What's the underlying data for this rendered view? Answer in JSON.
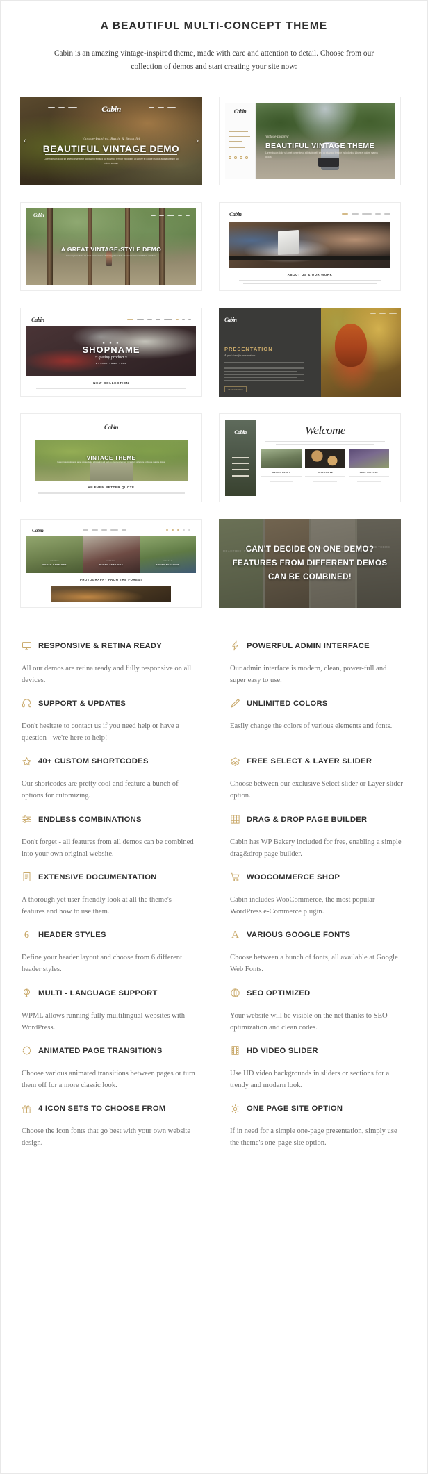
{
  "header": {
    "title": "A BEAUTIFUL MULTI-CONCEPT THEME",
    "subtitle": "Cabin is an amazing vintage-inspired theme, made with care and attention to detail. Choose from our collection of demos and start creating your site now:"
  },
  "brand": {
    "name": "Cabin",
    "accent": "#c9a96a",
    "text_dark": "#2e2e2e",
    "text_muted": "#6e6e6e"
  },
  "demos": [
    {
      "id": "beautiful-vintage-demo",
      "logo": "Cabin",
      "tagline": "Vintage-Inspired, Rustic & Beautiful",
      "headline": "BEAUTIFUL VINTAGE DEMO",
      "blurb": "Lorem ipsum dolor sit amet consectetur adipiscing elit sed do eiusmod tempor incididunt ut labore et dolore magna aliqua ut enim ad minim veniam",
      "prev": "‹",
      "next": "›"
    },
    {
      "id": "beautiful-vintage-theme",
      "logo": "Cabin",
      "eyebrow": "Vintage-Inspired",
      "headline": "BEAUTIFUL VINTAGE THEME",
      "blurb": "Lorem ipsum dolor sit amet consectetur adipiscing elit sed do eiusmod tempor incididunt ut labore et dolore magna aliqua"
    },
    {
      "id": "great-vintage-style-demo",
      "logo": "Cabin",
      "headline": "A GREAT VINTAGE-STYLE DEMO",
      "blurb": "Lorem ipsum dolor sit amet consectetur adipiscing elit sed do eiusmod tempor incididunt ut labore"
    },
    {
      "id": "about-us-our-work",
      "logo": "Cabin",
      "caption": "ABOUT US & OUR WORK"
    },
    {
      "id": "shopname-new-collection",
      "logo": "Cabin",
      "badge_stars": "★ ★ ★",
      "badge_name": "SHOPNAME",
      "badge_quality": "~ quality product ~",
      "badge_est": "ESTABLISHED 1984",
      "caption": "NEW COLLECTION",
      "nav": [
        "HOME",
        "PAGES",
        "BLOG",
        "SHOP",
        "CONTACT"
      ]
    },
    {
      "id": "presentation",
      "logo": "Cabin",
      "title": "PRESENTATION",
      "subtitle": "A great demo for presentations",
      "button": "LEARN MORE"
    },
    {
      "id": "vintage-theme-quote",
      "logo": "Cabin",
      "headline": "VINTAGE THEME",
      "blurb": "Lorem ipsum dolor sit amet consectetur adipiscing elit sed do eiusmod tempor incididunt ut labore et dolore magna aliqua",
      "caption": "AN EVEN BETTER QUOTE",
      "nav": [
        "HOME",
        "PAGES",
        "PORTFOLIO",
        "BLOG",
        "CONTACT"
      ]
    },
    {
      "id": "welcome",
      "logo": "Cabin",
      "welcome": "Welcome",
      "thumb_captions": [
        "RETINA READY",
        "RESPONSIVE",
        "FREE SUPPORT"
      ],
      "nav": [
        "HOME",
        "PAGES",
        "PORTFOLIO",
        "BLOG",
        "CONTACT"
      ]
    },
    {
      "id": "photo-sessions",
      "logo": "Cabin",
      "tiles": [
        {
          "eyebrow": "VINTAGE",
          "label": "PHOTO SESSIONS"
        },
        {
          "eyebrow": "VINTAGE",
          "label": "PHOTO SESSIONS"
        },
        {
          "eyebrow": "VINTAGE",
          "label": "PHOTO SESSIONS"
        }
      ],
      "caption": "PHOTOGRAPHY FROM THE FOREST",
      "nav": [
        "HOME",
        "ABOUT",
        "PAGES",
        "CONTACT",
        "SHOP"
      ]
    },
    {
      "id": "combine-demos-callout",
      "message": "CAN'T DECIDE ON ONE DEMO? FEATURES FROM DIFFERENT DEMOS CAN BE COMBINED!",
      "ghost_labels": [
        "BEAUTIFUL VINTAGE DEMO",
        "BEAUTIFUL VINTAGE DEMO",
        "BEAUTIFUL VINTAGE THEME"
      ]
    }
  ],
  "features": [
    {
      "icon": "monitor-icon",
      "title": "RESPONSIVE & RETINA READY",
      "desc": "All our demos are retina ready and fully responsive on all devices."
    },
    {
      "icon": "lightning-bolt-icon",
      "title": "POWERFUL ADMIN INTERFACE",
      "desc": "Our admin interface is modern, clean, power-full and super easy to use."
    },
    {
      "icon": "headphones-icon",
      "title": "SUPPORT & UPDATES",
      "desc": "Don't hesitate to contact us if you need help or have a question - we're here to help!"
    },
    {
      "icon": "pencil-icon",
      "title": "UNLIMITED COLORS",
      "desc": "Easily change the colors of various elements and fonts."
    },
    {
      "icon": "star-icon",
      "title": "40+ CUSTOM SHORTCODES",
      "desc": "Our shortcodes are pretty cool and feature a bunch of options for cutomizing."
    },
    {
      "icon": "layers-icon",
      "title": "FREE SELECT & LAYER SLIDER",
      "desc": "Choose between our exclusive Select slider or Layer slider option."
    },
    {
      "icon": "sliders-icon",
      "title": "ENDLESS COMBINATIONS",
      "desc": "Don't forget - all features from all demos can be combined into your own original website."
    },
    {
      "icon": "grid-icon",
      "title": "DRAG & DROP PAGE BUILDER",
      "desc": "Cabin has WP Bakery included for free, enabling a simple drag&drop page builder."
    },
    {
      "icon": "document-icon",
      "title": "EXTENSIVE DOCUMENTATION",
      "desc": "A thorough yet user-friendly look at all the theme's features and how to use them."
    },
    {
      "icon": "shopping-cart-icon",
      "title": "WOOCOMMERCE SHOP",
      "desc": "Cabin includes WooCommerce, the most popular WordPress e-Commerce plugin."
    },
    {
      "icon": "number-six-icon",
      "title": "HEADER STYLES",
      "desc": "Define your header layout and choose from 6 different header styles."
    },
    {
      "icon": "letter-a-icon",
      "title": "VARIOUS GOOGLE FONTS",
      "desc": "Choose between a bunch of fonts, all available at Google Web Fonts."
    },
    {
      "icon": "globe-stand-icon",
      "title": "MULTI - LANGUAGE SUPPORT",
      "desc": "WPML allows running fully multilingual websites with WordPress."
    },
    {
      "icon": "globe-icon",
      "title": "SEO OPTIMIZED",
      "desc": "Your website will be visible on the net thanks to SEO optimization and clean codes."
    },
    {
      "icon": "spinner-icon",
      "title": "ANIMATED PAGE TRANSITIONS",
      "desc": "Choose various animated transitions between pages or turn them off for a more classic look."
    },
    {
      "icon": "film-strip-icon",
      "title": "HD VIDEO SLIDER",
      "desc": "Use HD video backgrounds in sliders or sections for a trendy and modern look."
    },
    {
      "icon": "gift-icon",
      "title": "4 ICON SETS TO CHOOSE FROM",
      "desc": "Choose the icon fonts that go best with your own website design."
    },
    {
      "icon": "gear-icon",
      "title": "ONE PAGE SITE OPTION",
      "desc": "If in need for a simple one-page presentation, simply use the theme's one-page site option."
    }
  ]
}
